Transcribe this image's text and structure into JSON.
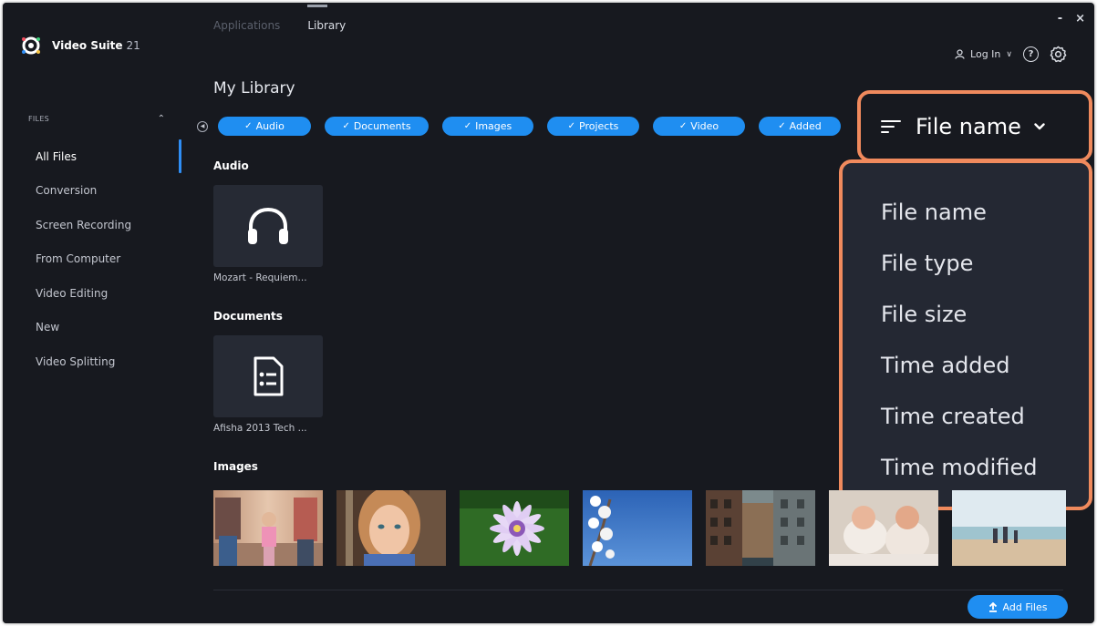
{
  "app": {
    "name": "Video Suite",
    "version": "21"
  },
  "window_controls": {
    "minimize": "-",
    "close": "×"
  },
  "top_tabs": [
    {
      "label": "Applications",
      "active": false
    },
    {
      "label": "Library",
      "active": true
    }
  ],
  "user_bar": {
    "login_label": "Log In",
    "login_caret": "∨",
    "help": "?",
    "settings_icon": "gear-icon"
  },
  "sidebar": {
    "section_label": "FILES",
    "items": [
      {
        "label": "All Files",
        "active": true
      },
      {
        "label": "Conversion"
      },
      {
        "label": "Screen Recording"
      },
      {
        "label": "From Computer"
      },
      {
        "label": "Video Editing"
      },
      {
        "label": "New"
      },
      {
        "label": "Video Splitting"
      }
    ]
  },
  "page_title": "My Library",
  "filters": [
    {
      "label": "Audio",
      "checked": true
    },
    {
      "label": "Documents",
      "checked": true
    },
    {
      "label": "Images",
      "checked": true
    },
    {
      "label": "Projects",
      "checked": true
    },
    {
      "label": "Video",
      "checked": true
    },
    {
      "label": "Added",
      "checked": true
    }
  ],
  "sort": {
    "selected": "File name",
    "options": [
      "File name",
      "File type",
      "File size",
      "Time added",
      "Time created",
      "Time modified"
    ]
  },
  "sections": {
    "audio": {
      "title": "Audio",
      "file": "Mozart - Requiem...",
      "icon": "headphones-icon"
    },
    "documents": {
      "title": "Documents",
      "file": "Afisha 2013 Tech ...",
      "icon": "document-icon"
    },
    "images": {
      "title": "Images"
    }
  },
  "add_files_label": "Add Files",
  "colors": {
    "accent": "#1f8ef1",
    "highlight": "#f08a5d",
    "background": "#17191f",
    "dropdown": "#242833"
  }
}
